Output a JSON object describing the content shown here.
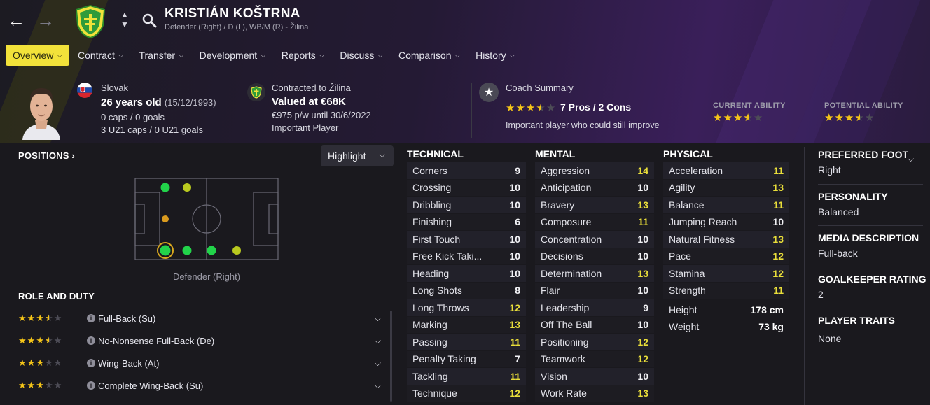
{
  "header": {
    "player_name": "KRISTIÁN KOŠTRNA",
    "player_subtitle": "Defender (Right) / D (L), WB/M (R) - Žilina",
    "back_icon": "arrow-left-icon",
    "forward_icon": "arrow-right-icon",
    "search_icon": "search-icon"
  },
  "tabs": [
    {
      "label": "Overview",
      "active": true
    },
    {
      "label": "Contract"
    },
    {
      "label": "Transfer"
    },
    {
      "label": "Development"
    },
    {
      "label": "Reports"
    },
    {
      "label": "Discuss"
    },
    {
      "label": "Comparison"
    },
    {
      "label": "History"
    }
  ],
  "summary": {
    "nationality": "Slovak",
    "age": "26 years old",
    "dob": "(15/12/1993)",
    "caps": "0 caps / 0 goals",
    "u21_caps": "3 U21 caps / 0 U21 goals",
    "contract_label": "Contracted to Žilina",
    "value": "Valued at €68K",
    "wage": "€975 p/w until 30/6/2022",
    "status": "Important Player",
    "coach_title": "Coach Summary",
    "coach_pros_cons": "7 Pros / 2 Cons",
    "coach_rating": 3.5,
    "coach_text": "Important player who could still improve",
    "current_ability_label": "CURRENT ABILITY",
    "current_ability": 3.5,
    "potential_ability_label": "POTENTIAL ABILITY",
    "potential_ability": 3.5
  },
  "positions": {
    "title": "POSITIONS",
    "highlight_label": "Highlight",
    "caption": "Defender (Right)"
  },
  "roles": {
    "title": "ROLE AND DUTY",
    "items": [
      {
        "name": "Full-Back (Su)",
        "stars": 3.5
      },
      {
        "name": "No-Nonsense Full-Back (De)",
        "stars": 3.5
      },
      {
        "name": "Wing-Back (At)",
        "stars": 3
      },
      {
        "name": "Complete Wing-Back (Su)",
        "stars": 3
      }
    ]
  },
  "attributes": {
    "technical_title": "TECHNICAL",
    "mental_title": "MENTAL",
    "physical_title": "PHYSICAL",
    "technical": [
      {
        "name": "Corners",
        "value": "9"
      },
      {
        "name": "Crossing",
        "value": "10"
      },
      {
        "name": "Dribbling",
        "value": "10"
      },
      {
        "name": "Finishing",
        "value": "6"
      },
      {
        "name": "First Touch",
        "value": "10"
      },
      {
        "name": "Free Kick Taki...",
        "value": "10"
      },
      {
        "name": "Heading",
        "value": "10"
      },
      {
        "name": "Long Shots",
        "value": "8"
      },
      {
        "name": "Long Throws",
        "value": "12"
      },
      {
        "name": "Marking",
        "value": "13"
      },
      {
        "name": "Passing",
        "value": "11"
      },
      {
        "name": "Penalty Taking",
        "value": "7"
      },
      {
        "name": "Tackling",
        "value": "11"
      },
      {
        "name": "Technique",
        "value": "12"
      }
    ],
    "mental": [
      {
        "name": "Aggression",
        "value": "14"
      },
      {
        "name": "Anticipation",
        "value": "10"
      },
      {
        "name": "Bravery",
        "value": "13"
      },
      {
        "name": "Composure",
        "value": "11"
      },
      {
        "name": "Concentration",
        "value": "10"
      },
      {
        "name": "Decisions",
        "value": "10"
      },
      {
        "name": "Determination",
        "value": "13"
      },
      {
        "name": "Flair",
        "value": "10"
      },
      {
        "name": "Leadership",
        "value": "9"
      },
      {
        "name": "Off The Ball",
        "value": "10"
      },
      {
        "name": "Positioning",
        "value": "12"
      },
      {
        "name": "Teamwork",
        "value": "12"
      },
      {
        "name": "Vision",
        "value": "10"
      },
      {
        "name": "Work Rate",
        "value": "13"
      }
    ],
    "physical": [
      {
        "name": "Acceleration",
        "value": "11"
      },
      {
        "name": "Agility",
        "value": "13"
      },
      {
        "name": "Balance",
        "value": "11"
      },
      {
        "name": "Jumping Reach",
        "value": "10"
      },
      {
        "name": "Natural Fitness",
        "value": "13"
      },
      {
        "name": "Pace",
        "value": "12"
      },
      {
        "name": "Stamina",
        "value": "12"
      },
      {
        "name": "Strength",
        "value": "11"
      }
    ],
    "height_label": "Height",
    "height": "178 cm",
    "weight_label": "Weight",
    "weight": "73 kg"
  },
  "right_panel": {
    "foot_title": "PREFERRED FOOT",
    "foot": "Right",
    "personality_title": "PERSONALITY",
    "personality": "Balanced",
    "media_title": "MEDIA DESCRIPTION",
    "media": "Full-back",
    "gk_title": "GOALKEEPER RATING",
    "gk": "2",
    "traits_title": "PLAYER TRAITS",
    "traits": "None"
  },
  "colors": {
    "accent": "#f2e23a",
    "star": "#f5c518",
    "highlight_value": "#e9de3a",
    "position_natural": "#22d34a",
    "position_accomplished": "#b9c91f",
    "position_unconvincing": "#d99a1e"
  }
}
